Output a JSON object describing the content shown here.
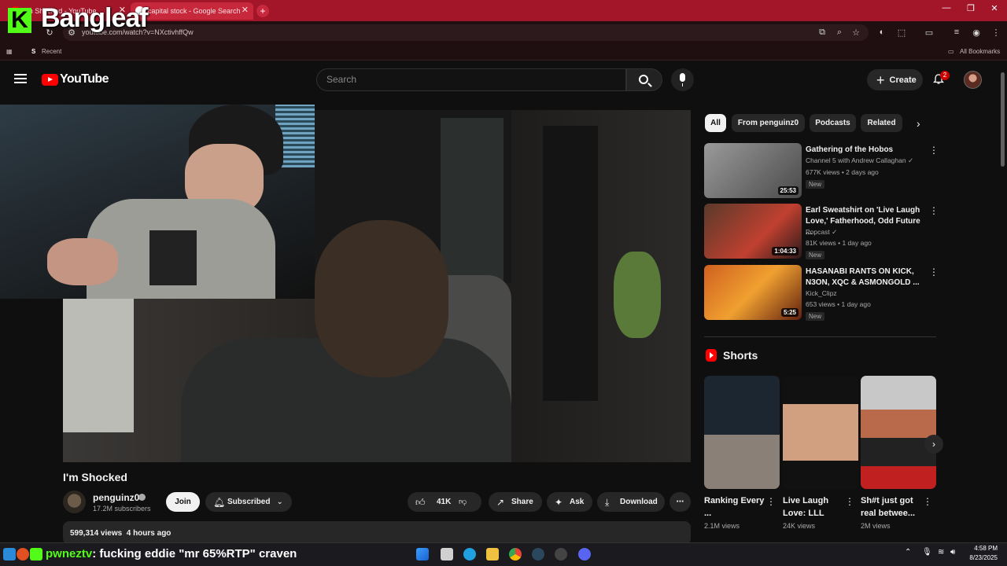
{
  "browser": {
    "tabs": [
      {
        "label": "I'm Shocked - YouTube"
      },
      {
        "label": "capital stock - Google Search"
      }
    ],
    "url": "youtube.com/watch?v=NXctivhffQw",
    "bookmarks": {
      "recent": "Recent",
      "all": "All Bookmarks"
    },
    "new_tab": "+"
  },
  "overlay": {
    "brand_letter": "K",
    "brand_name": "Bangleaf"
  },
  "youtube": {
    "wordmark": "YouTube",
    "search_placeholder": "Search",
    "create_label": "Create",
    "notification_count": "2"
  },
  "video": {
    "title": "I'm Shocked",
    "channel": "penguinz0",
    "subscribers": "17.2M subscribers",
    "join_label": "Join",
    "subscribed_label": "Subscribed",
    "likes": "41K",
    "share_label": "Share",
    "ask_label": "Ask",
    "download_label": "Download",
    "views": "599,314 views",
    "age": "4 hours ago"
  },
  "chips": [
    "All",
    "From penguinz0",
    "Podcasts",
    "Related"
  ],
  "recommendations": [
    {
      "title": "Gathering of the Hobos",
      "channel": "Channel 5 with Andrew Callaghan",
      "meta": "677K views • 2 days ago",
      "badge": "New",
      "duration": "25:53",
      "verified": true
    },
    {
      "title": "Earl Sweatshirt on 'Live Laugh Love,' Fatherhood, Odd Future ...",
      "channel": "Popcast",
      "meta": "81K views • 1 day ago",
      "badge": "New",
      "duration": "1:04:33",
      "verified": true
    },
    {
      "title": "HASANABI RANTS ON KICK, N3ON, XQC & ASMONGOLD ...",
      "channel": "Kick_Clipz",
      "meta": "653 views • 1 day ago",
      "badge": "New",
      "duration": "5:25",
      "verified": false
    }
  ],
  "shorts": {
    "heading": "Shorts",
    "items": [
      {
        "title": "Ranking Every ...",
        "views": "2.1M views"
      },
      {
        "title": "Live Laugh Love: LLL",
        "views": "24K views"
      },
      {
        "title": "Sh#t just got real betwee...",
        "views": "2M views"
      }
    ]
  },
  "stream_chat": {
    "user": "pwneztv",
    "message": ": fucking eddie \"mr 65%RTP\" craven"
  },
  "system_tray": {
    "time": "4:58 PM",
    "date": "8/23/2025"
  },
  "colors": {
    "yt_red": "#ff0000",
    "kick_green": "#53fc18",
    "browser_theme": "#a3162a"
  }
}
